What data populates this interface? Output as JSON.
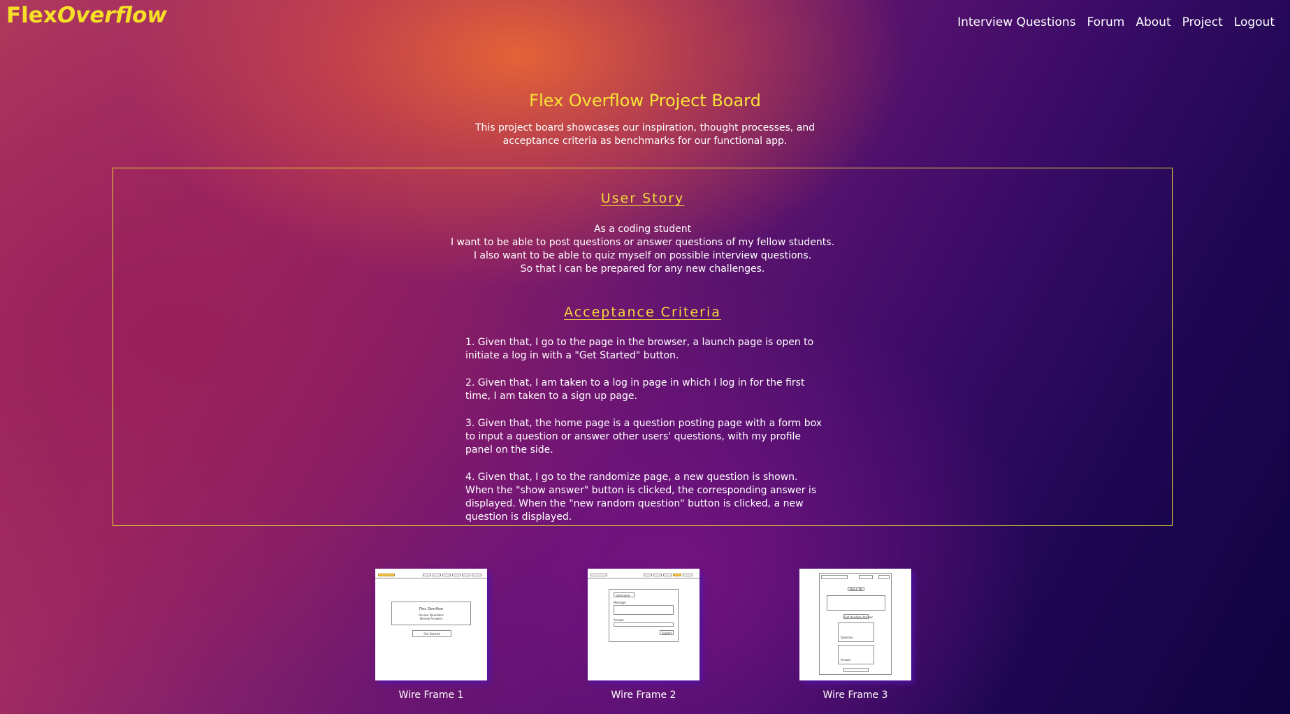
{
  "brand": {
    "part1": "Flex",
    "part2": "Overflow"
  },
  "nav": {
    "items": [
      {
        "label": "Interview Questions"
      },
      {
        "label": "Forum"
      },
      {
        "label": "About"
      },
      {
        "label": "Project"
      },
      {
        "label": "Logout"
      }
    ]
  },
  "header": {
    "title": "Flex Overflow Project Board",
    "intro": "This project board showcases our inspiration, thought processes, and acceptance criteria as benchmarks for our functional app."
  },
  "user_story": {
    "heading": "User Story",
    "lines": [
      "As a coding student",
      "I want to be able to post questions or answer questions of my fellow students.",
      "I also want to be able to quiz myself on possible interview questions.",
      "So that I can be prepared for any new challenges."
    ]
  },
  "acceptance": {
    "heading": "Acceptance Criteria",
    "items": [
      "1. Given that, I go to the page in the browser, a launch page is open to initiate a log in with a \"Get Started\" button.",
      "2. Given that, I am taken to a log in page in which I log in for the first time, I am taken to a sign up page.",
      "3. Given that, the home page is a question posting page with a form box to input a question or answer other users' questions, with my profile panel on the side.",
      "4. Given that, I go to the randomize page, a new question is shown. When the \"show answer\" button is clicked, the corresponding answer is displayed. When the \"new random question\" button is clicked, a new question is displayed."
    ]
  },
  "wireframes": [
    {
      "caption": "Wire Frame 1",
      "sketch": {
        "title": "Flex Overflow",
        "sub1": "Review Questions",
        "sub2": "Review Answers",
        "button": "Get Started"
      }
    },
    {
      "caption": "Wire Frame 2",
      "sketch": {
        "field1": "Username",
        "field2": "Message",
        "field3": "Answer",
        "button": "Submit"
      }
    },
    {
      "caption": "Wire Frame 3",
      "sketch": {
        "heading": "About Me",
        "button": "Get Random Answer",
        "label1": "Question",
        "label2": "Answer"
      }
    }
  ],
  "colors": {
    "accent": "#f5e026",
    "border": "#e8d631",
    "text": "#ffffff",
    "background_warm": "#e86634",
    "background_dark": "#0f0440"
  }
}
